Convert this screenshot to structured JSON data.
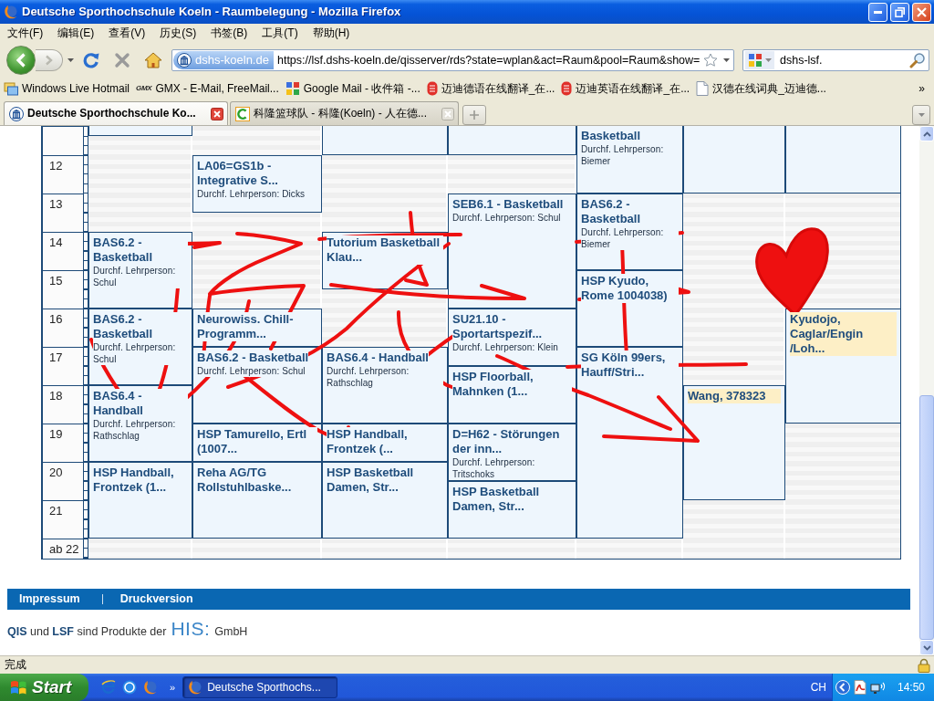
{
  "window": {
    "title": "Deutsche Sporthochschule Koeln - Raumbelegung - Mozilla Firefox"
  },
  "menu": [
    "文件(F)",
    "编辑(E)",
    "查看(V)",
    "历史(S)",
    "书签(B)",
    "工具(T)",
    "帮助(H)"
  ],
  "navigation": {
    "site": "dshs-koeln.de",
    "url": "https://lsf.dshs-koeln.de/qisserver/rds?state=wplan&act=Raum&pool=Raum&show=",
    "search": "dshs-lsf."
  },
  "bookmarks": [
    {
      "label": "Windows Live Hotmail",
      "kind": "live"
    },
    {
      "label": "GMX - E-Mail, FreeMail...",
      "kind": "wordmark",
      "logo": "GMX"
    },
    {
      "label": "Google Mail - 收件箱 -...",
      "kind": "blocks"
    },
    {
      "label": "迈迪德语在线翻译_在...",
      "kind": "seal"
    },
    {
      "label": "迈迪英语在线翻译_在...",
      "kind": "seal"
    },
    {
      "label": "汉德在线词典_迈迪德...",
      "kind": "page"
    }
  ],
  "bookmarks_more": "»",
  "tabs": [
    {
      "label": "Deutsche Sporthochschule Ko...",
      "selected": true,
      "kind": "columns"
    },
    {
      "label": "科隆篮球队 - 科隆(Koeln) - 人在德...",
      "selected": false,
      "kind": "arc"
    }
  ],
  "timetable": {
    "hours": [
      "12",
      "13",
      "14",
      "15",
      "16",
      "17",
      "18",
      "19",
      "20",
      "21",
      "ab 22"
    ],
    "columns": [
      [
        {
          "kind": "partial"
        },
        {
          "kind": "course",
          "title": "BAS6.2 - Basketball",
          "teacher": "Durchf. Lehrperson: Schul",
          "highlighted": false
        },
        {
          "kind": "course",
          "title": "BAS6.2 - Basketball",
          "teacher": "Durchf. Lehrperson: Schul",
          "highlighted": false
        },
        {
          "kind": "course",
          "title": "BAS6.4 - Handball",
          "teacher": "Durchf. Lehrperson: Rathschlag",
          "highlighted": false
        },
        {
          "kind": "course",
          "title": "HSP Handball, Frontzek (1...",
          "highlighted": false
        }
      ],
      [
        {
          "kind": "course",
          "title": "LA06=GS1b - Integrative S...",
          "teacher": "Durchf. Lehrperson: Dicks",
          "highlighted": false
        },
        {
          "kind": "course",
          "title": "Neurowiss. Chill-Programm...",
          "highlighted": false
        },
        {
          "kind": "course",
          "title": "BAS6.2 - Basketball",
          "teacher": "Durchf. Lehrperson: Schul",
          "highlighted": false
        },
        {
          "kind": "course",
          "title": "HSP Tamurello, Ertl (1007...",
          "highlighted": false
        },
        {
          "kind": "course",
          "title": "Reha AG/TG Rollstuhlbaske...",
          "highlighted": false
        }
      ],
      [
        {
          "kind": "partial"
        },
        {
          "kind": "course",
          "title": "Tutorium Basketball Klau...",
          "highlighted": false
        },
        {
          "kind": "course",
          "title": "BAS6.4 - Handball",
          "teacher": "Durchf. Lehrperson: Rathschlag",
          "highlighted": false
        },
        {
          "kind": "course",
          "title": "HSP Handball, Frontzek (...",
          "highlighted": false
        },
        {
          "kind": "course",
          "title": "HSP Basketball Damen, Str...",
          "highlighted": false
        }
      ],
      [
        {
          "kind": "partial"
        },
        {
          "kind": "course",
          "title": "SEB6.1 - Basketball",
          "teacher": "Durchf. Lehrperson: Schul",
          "highlighted": false
        },
        {
          "kind": "course",
          "title": "SU21.10 - Sportartspezif...",
          "teacher": "Durchf. Lehrperson: Klein",
          "highlighted": false
        },
        {
          "kind": "course",
          "title": "HSP Floorball, Mahnken (1...",
          "highlighted": false
        },
        {
          "kind": "course",
          "title": "D=H62 - Störungen der inn...",
          "teacher": "Durchf. Lehrperson: Tritschoks",
          "highlighted": false
        },
        {
          "kind": "course",
          "title": "HSP Basketball Damen, Str...",
          "highlighted": false
        }
      ],
      [
        {
          "kind": "partial",
          "title": "Basketball",
          "teacher": "Durchf. Lehrperson: Biemer",
          "highlighted": false
        },
        {
          "kind": "course",
          "title": "BAS6.2 - Basketball",
          "teacher": "Durchf. Lehrperson: Biemer",
          "highlighted": false
        },
        {
          "kind": "course",
          "title": "HSP Kyudo, Rome 1004038)",
          "highlighted": false
        },
        {
          "kind": "course",
          "title": "SG Köln 99ers, Hauff/Stri...",
          "highlighted": false
        }
      ],
      [
        {
          "kind": "partial"
        },
        {
          "kind": "course",
          "title": "Wang, 378323",
          "highlighted": true
        }
      ],
      [
        {
          "kind": "partial"
        },
        {
          "kind": "course",
          "title": "Kyudojo, Caglar/Engin /Loh...",
          "highlighted": true
        }
      ]
    ]
  },
  "footer": {
    "links": [
      "Impressum",
      "Druckversion"
    ],
    "credit": "**QIS** und **LSF** sind Produkte der",
    "logo": "HIS:",
    "company": "GmbH"
  },
  "status_bar": {
    "text": "完成"
  },
  "taskbar": {
    "start": "Start",
    "quick_more": "»",
    "tasks": [
      {
        "label": "Deutsche Sporthochs...",
        "selected": true
      }
    ],
    "language": "CH",
    "clock": "14:50"
  },
  "pen_marks": {
    "strokes": true,
    "heart": true
  }
}
